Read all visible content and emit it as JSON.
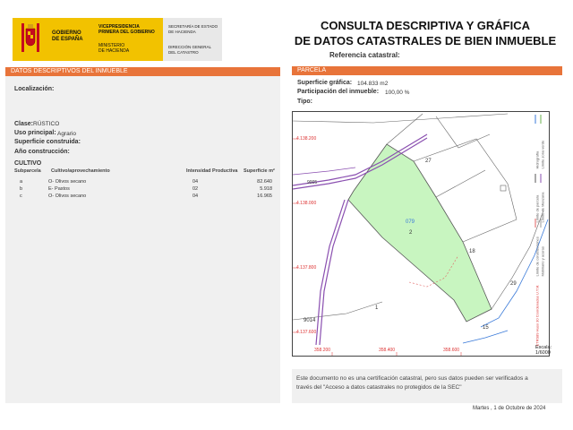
{
  "header": {
    "gobierno": [
      "GOBIERNO",
      "DE ESPAÑA"
    ],
    "vicepresidencia": [
      "VICEPRESIDENCIA",
      "PRIMERA DEL GOBIERNO"
    ],
    "ministerio": [
      "MINISTERIO",
      "DE HACIENDA"
    ],
    "secretaria": [
      "SECRETARÍA DE ESTADO",
      "DE HACIENDA"
    ],
    "direccion": [
      "DIRECCIÓN GENERAL",
      "DEL CATASTRO"
    ],
    "title_line1": "CONSULTA DESCRIPTIVA Y GRÁFICA",
    "title_line2": "DE DATOS CATASTRALES DE BIEN INMUEBLE",
    "ref_label": "Referencia catastral:",
    "brand_color": "#f2c200",
    "accent_color": "#e8743a"
  },
  "left": {
    "section_title": "DATOS DESCRIPTIVOS DEL INMUEBLE",
    "localizacion_label": "Localización:",
    "clase_label": "Clase:",
    "clase_value": "RÚSTICO",
    "uso_label": "Uso principal:",
    "uso_value": "Agrario",
    "superficie_label": "Superficie construida:",
    "anio_label": "Año construcción:",
    "cultivo_title": "CULTIVO",
    "cultivo_headers": [
      "Subparcela",
      "Cultivo/aprovechamiento",
      "Intensidad Productiva",
      "Superficie m²"
    ],
    "cultivo_rows": [
      {
        "sub": "a",
        "cultivo": "O- Olivos secano",
        "intensidad": "04",
        "superficie": "82.640"
      },
      {
        "sub": "b",
        "cultivo": "E- Pastos",
        "intensidad": "02",
        "superficie": "5.918"
      },
      {
        "sub": "c",
        "cultivo": "O- Olivos secano",
        "intensidad": "04",
        "superficie": "16.965"
      }
    ]
  },
  "right": {
    "section_title": "PARCELA",
    "sup_grafica_label": "Superficie gráfica:",
    "sup_grafica_value": "104.833 m2",
    "participacion_label": "Participación del inmueble:",
    "participacion_value": "100,00 %",
    "tipo_label": "Tipo:",
    "map": {
      "y_labels": [
        "4.138.200",
        "4.138.000",
        "4.137.800",
        "4.137.600"
      ],
      "x_labels": [
        "358.200",
        "358.400",
        "358.600"
      ],
      "parcel_numbers": [
        "27",
        "079",
        "2",
        "18",
        "1",
        "29",
        "15",
        "9014",
        "9005"
      ],
      "parcel_color": "#c8f5c0",
      "legend": [
        "Hidrografía",
        "Límite zona verde",
        "Límite de parcela",
        "Límite de Manzana",
        "Límite de construcciones",
        "Mobiliario y aceras"
      ],
      "coords_note": "ETRS89 Huso 30 Coordenadas U.T.M.",
      "scale_label": "Escala:",
      "scale_value": "1/6000"
    }
  },
  "footer": {
    "notice_line1": "Este documento no es una certificación catastral, pero sus datos pueden ser verificados a",
    "notice_line2": "través del \"Acceso a datos catastrales no protegidos de la SEC\"",
    "date": "Martes , 1 de Octubre de 2024"
  }
}
